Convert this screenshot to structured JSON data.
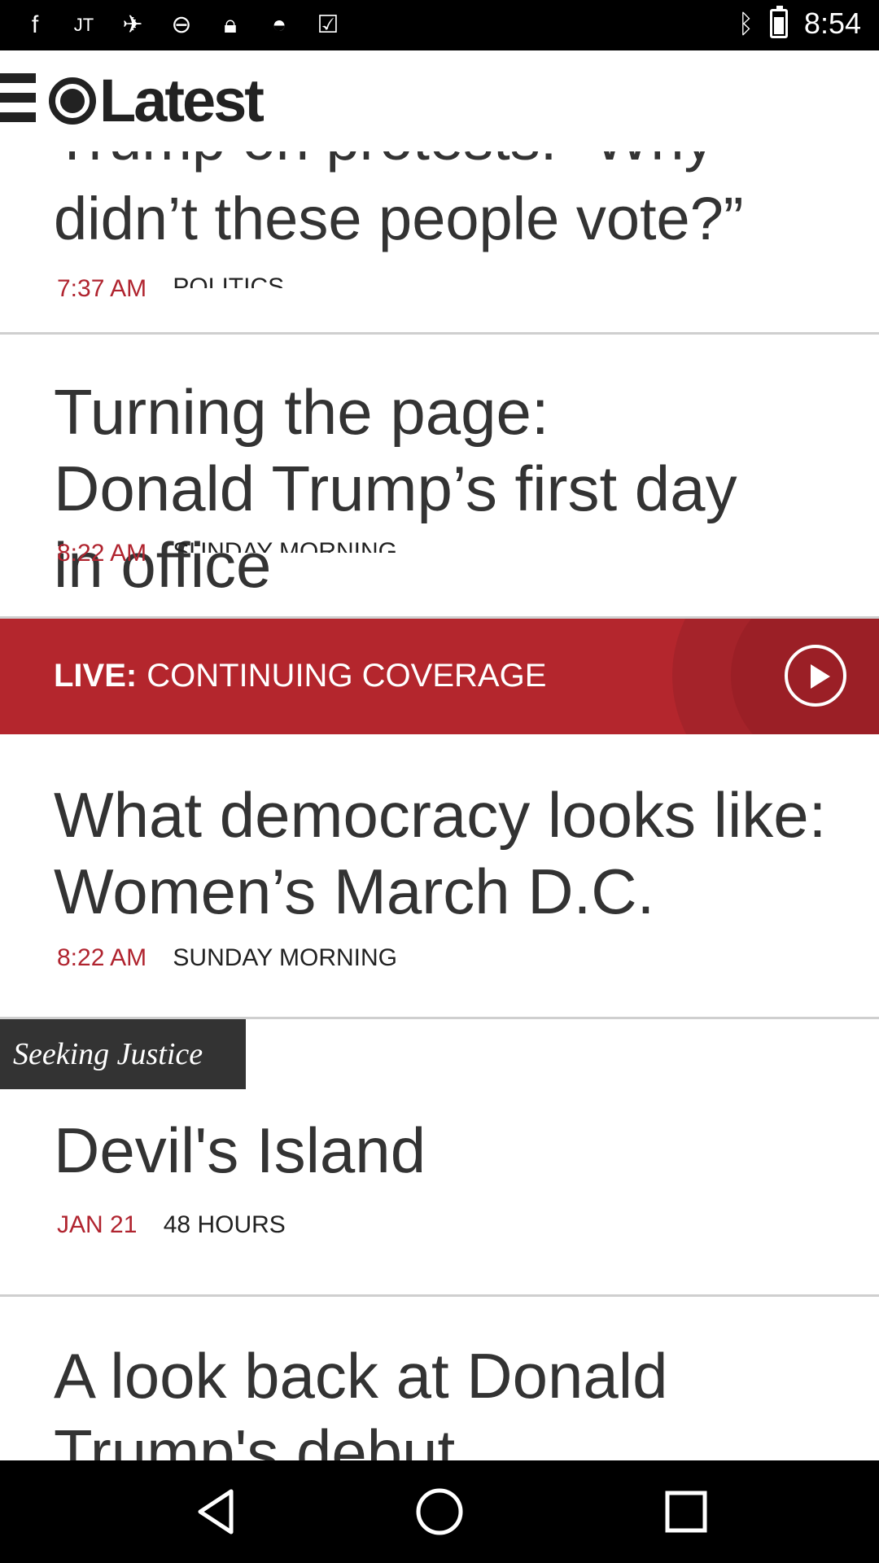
{
  "status_bar": {
    "time": "8:54",
    "icons": [
      "facebook-icon",
      "jt-icon",
      "fake-gps-icon",
      "dnd-icon",
      "lock-icon",
      "android-icon",
      "clipboard-icon",
      "bluetooth-icon",
      "battery-icon"
    ]
  },
  "header": {
    "title": "Latest"
  },
  "stories": [
    {
      "headline_partial": "Trump on protests: “Why",
      "headline": "didn’t these people vote?”",
      "time": "7:37 AM",
      "category": "POLITICS"
    },
    {
      "headline": "Turning the page: Donald Trump’s first day in office",
      "time": "8:22 AM",
      "category": "SUNDAY MORNING"
    },
    {
      "headline": "What democracy looks like: Women’s March D.C.",
      "time": "8:22 AM",
      "category": "SUNDAY MORNING"
    },
    {
      "headline": "Devil's Island",
      "time": "JAN 21",
      "category": "48 HOURS"
    },
    {
      "headline": "A look back at Donald Trump's debut"
    }
  ],
  "live_banner": {
    "prefix": "LIVE:",
    "text": "CONTINUING COVERAGE"
  },
  "section_tag": {
    "label": "Seeking Justice"
  },
  "colors": {
    "accent_red": "#b4262d",
    "time_red": "#b0242f"
  }
}
